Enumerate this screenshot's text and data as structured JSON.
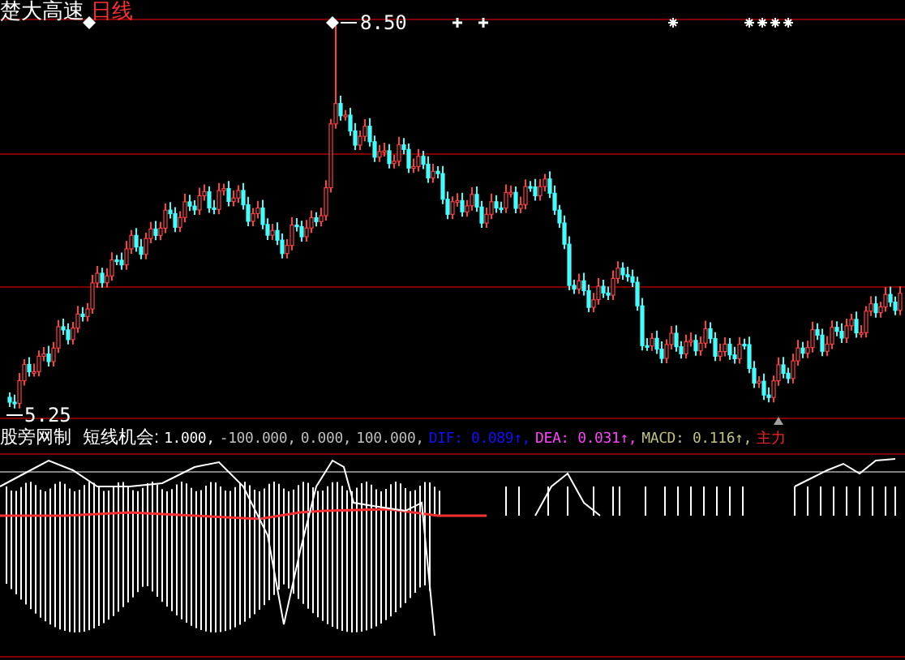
{
  "header": {
    "stock": "楚大高速",
    "period": "日线"
  },
  "price_labels": {
    "high": "8.50",
    "low": "5.25"
  },
  "indicator": {
    "name": "股旁网制",
    "title": "短线机会:",
    "items": [
      {
        "text": "1.000,",
        "color": "#ffffff"
      },
      {
        "text": "-100.000,",
        "color": "#c0c0c0"
      },
      {
        "text": "0.000,",
        "color": "#c0c0c0"
      },
      {
        "text": "100.000,",
        "color": "#c0c0c0"
      },
      {
        "text": "DIF: 0.089↑,",
        "color": "#1010ff"
      },
      {
        "text": "DEA: 0.031↑,",
        "color": "#ff40ff"
      },
      {
        "text": "MACD: 0.116↑,",
        "color": "#c0c080"
      },
      {
        "text": "主力",
        "color": "#ff2020"
      }
    ]
  }
}
